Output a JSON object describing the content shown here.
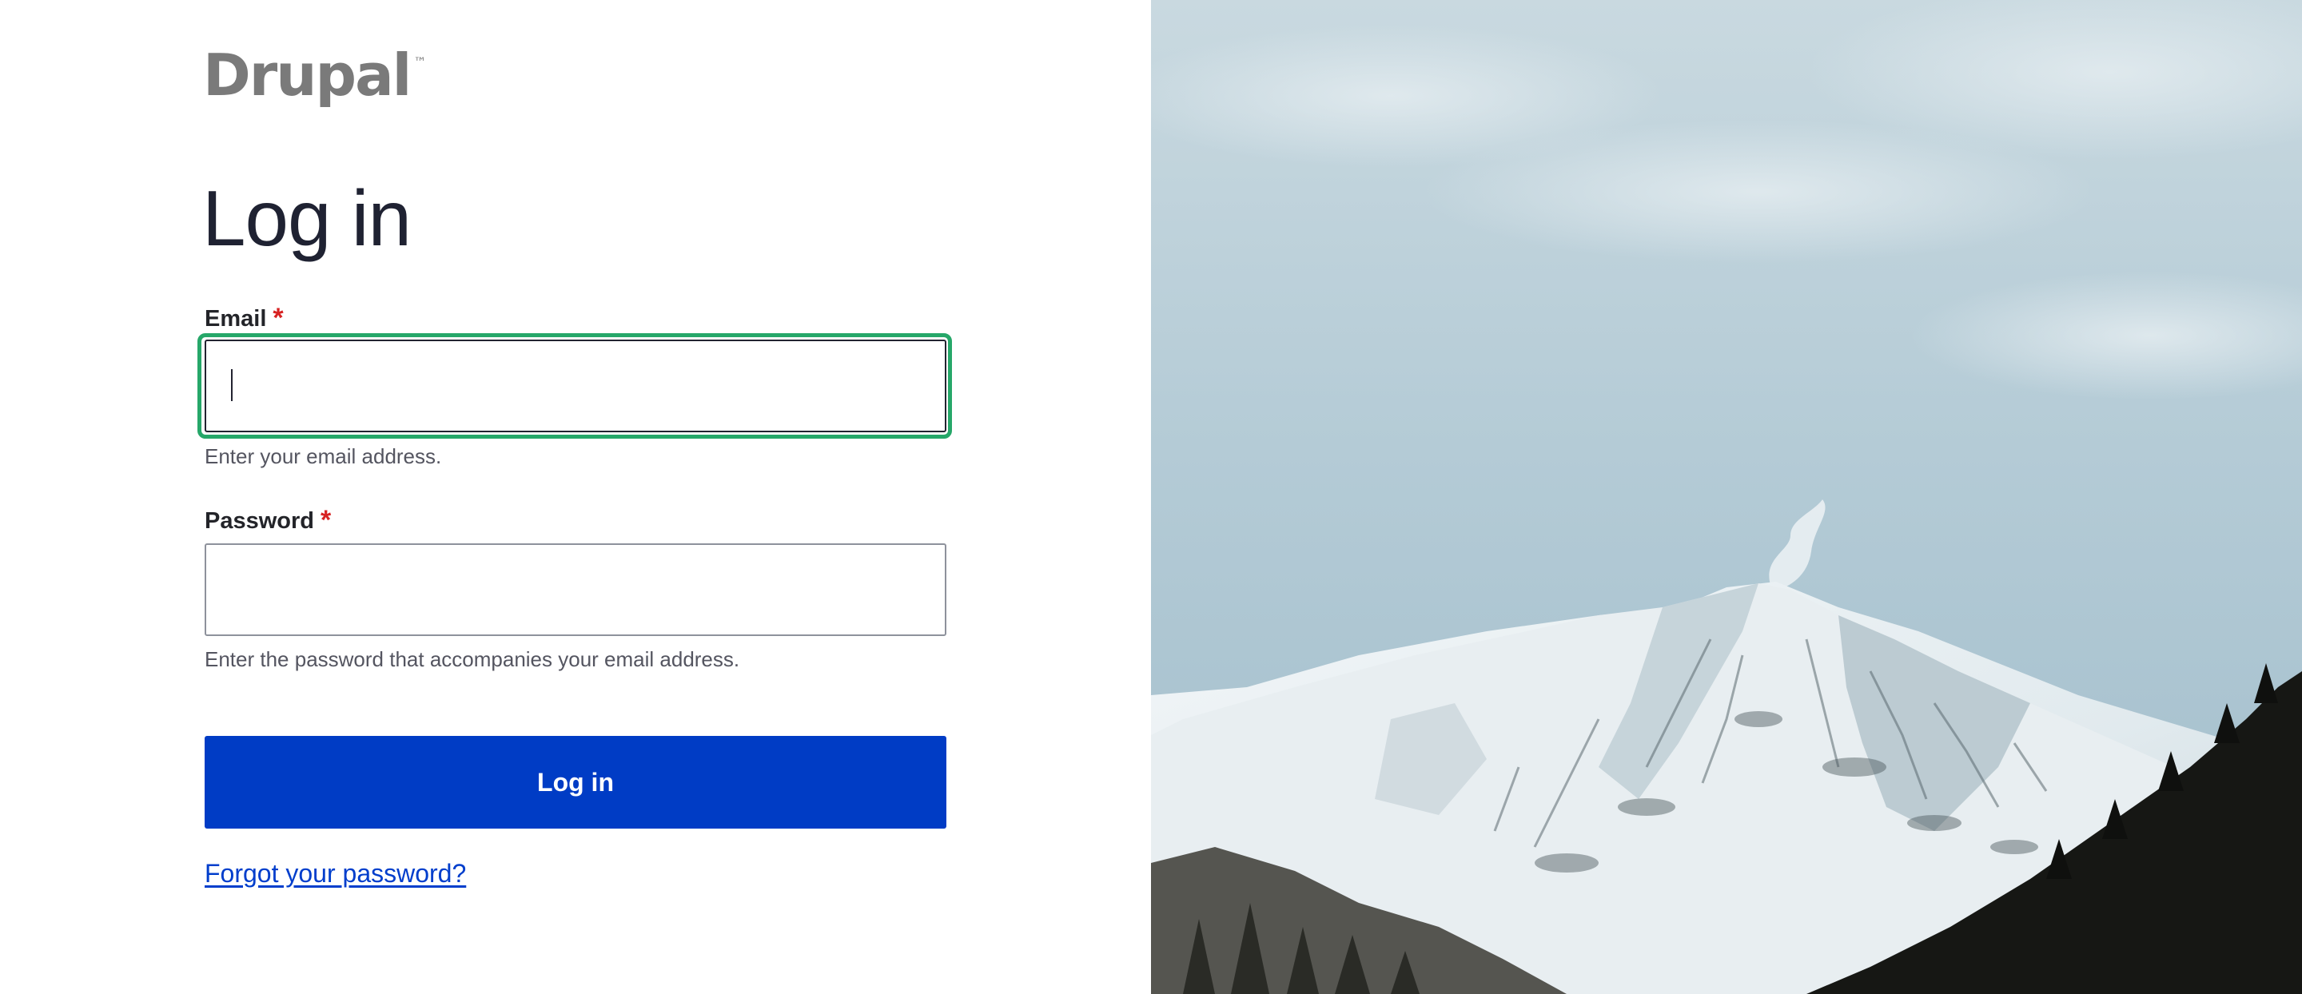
{
  "brand": {
    "name": "Drupal",
    "trademark": "™",
    "color": "#7a7a7a"
  },
  "page": {
    "title": "Log in"
  },
  "form": {
    "email": {
      "label": "Email",
      "required_marker": "*",
      "value": "",
      "help": "Enter your email address.",
      "focused": true
    },
    "password": {
      "label": "Password",
      "required_marker": "*",
      "value": "",
      "help": "Enter the password that accompanies your email address."
    },
    "submit_label": "Log in",
    "forgot_link": "Forgot your password?"
  },
  "colors": {
    "primary_button": "#003cc5",
    "link": "#003ecc",
    "focus_ring": "#26a769",
    "required": "#d72222",
    "heading": "#1f2232"
  },
  "background_image": {
    "subject": "snow-covered-mountain-peak"
  }
}
